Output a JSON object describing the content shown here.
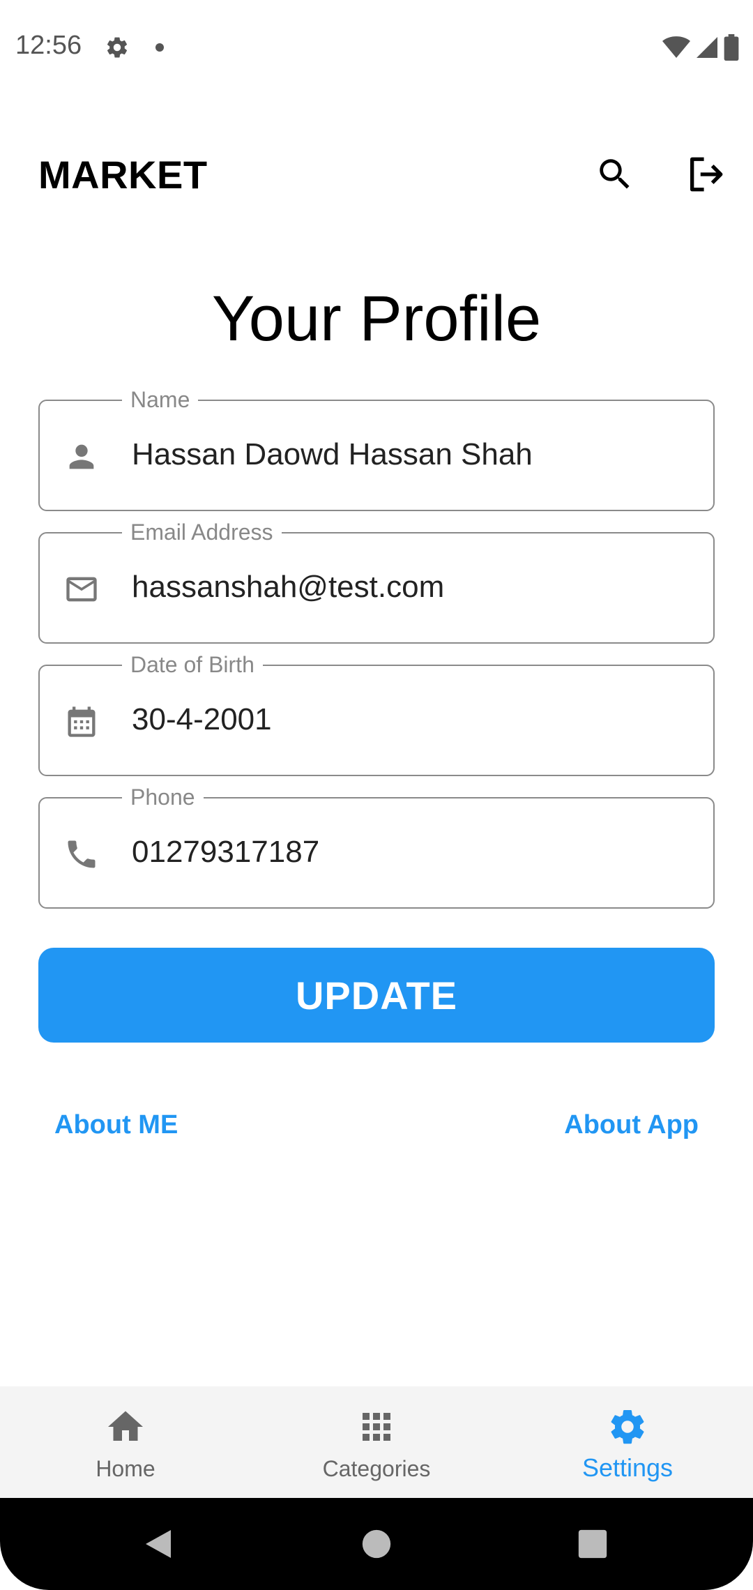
{
  "status_bar": {
    "time": "12:56"
  },
  "app_bar": {
    "title": "MARKET"
  },
  "page": {
    "title": "Your Profile"
  },
  "fields": {
    "name": {
      "label": "Name",
      "value": "Hassan Daowd Hassan Shah",
      "icon": "person-icon"
    },
    "email": {
      "label": "Email Address",
      "value": "hassanshah@test.com",
      "icon": "email-icon"
    },
    "dob": {
      "label": "Date of Birth",
      "value": "30-4-2001",
      "icon": "calendar-icon"
    },
    "phone": {
      "label": "Phone",
      "value": "01279317187",
      "icon": "phone-icon"
    }
  },
  "actions": {
    "update_label": "UPDATE"
  },
  "links": {
    "about_me": "About ME",
    "about_app": "About App"
  },
  "bottom_nav": {
    "items": [
      {
        "label": "Home",
        "icon": "home-icon"
      },
      {
        "label": "Categories",
        "icon": "grid-icon"
      },
      {
        "label": "Settings",
        "icon": "settings-icon",
        "active": true
      }
    ]
  },
  "colors": {
    "accent": "#2196f3",
    "field_border": "#8a8a8a",
    "label": "#888888"
  }
}
